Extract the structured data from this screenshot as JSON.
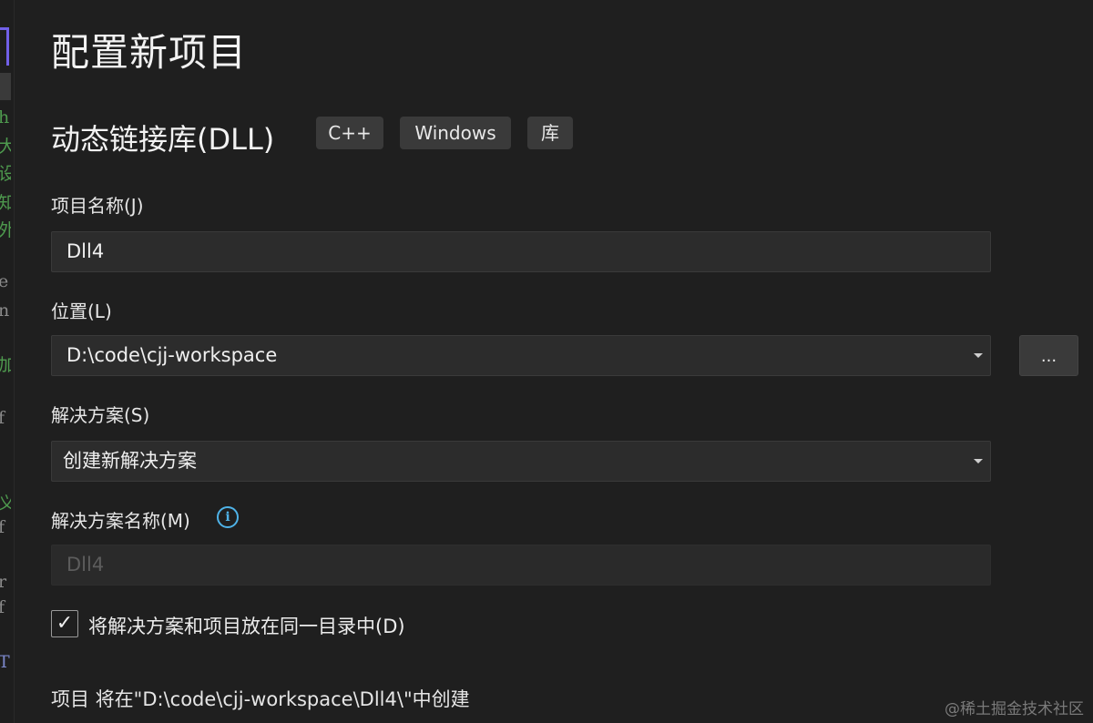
{
  "page_title": "配置新项目",
  "template": {
    "name": "动态链接库(DLL)",
    "tags": [
      "C++",
      "Windows",
      "库"
    ]
  },
  "project_name": {
    "label": "项目名称(J)",
    "value": "Dll4"
  },
  "location": {
    "label": "位置(L)",
    "value": "D:\\code\\cjj-workspace",
    "browse_label": "..."
  },
  "solution": {
    "label": "解决方案(S)",
    "value": "创建新解决方案"
  },
  "solution_name": {
    "label": "解决方案名称(M)",
    "value": "Dll4",
    "info_icon": "info-icon"
  },
  "same_dir": {
    "label": "将解决方案和项目放在同一目录中(D)",
    "checked": true,
    "check_glyph": "✓"
  },
  "summary": "项目 将在\"D:\\code\\cjj-workspace\\Dll4\\\"中创建",
  "watermark": "@稀土掘金技术社区",
  "colors": {
    "background": "#1f1f1f",
    "input": "#2c2c2c",
    "tag": "#3a3a3a",
    "info": "#4fb3e8",
    "accent": "#7160e8"
  }
}
